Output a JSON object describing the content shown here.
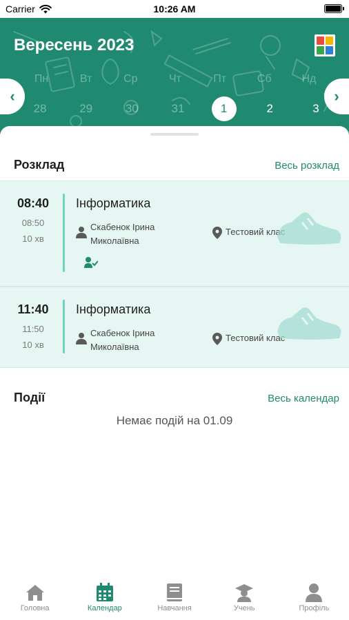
{
  "status_bar": {
    "carrier": "Carrier",
    "time": "10:26 AM"
  },
  "header": {
    "title": "Вересень 2023",
    "weekdays": [
      "Пн",
      "Вт",
      "Ср",
      "Чт",
      "Пт",
      "Сб",
      "Нд"
    ],
    "days": [
      "28",
      "29",
      "30",
      "31",
      "1",
      "2",
      "3"
    ],
    "selected_day": "1"
  },
  "schedule": {
    "title": "Розклад",
    "link": "Весь розклад",
    "lessons": [
      {
        "start": "08:40",
        "end": "08:50",
        "duration": "10 хв",
        "subject": "Інформатика",
        "teacher": "Скабенок Ірина Миколаївна",
        "room": "Тестовий клас"
      },
      {
        "start": "11:40",
        "end": "11:50",
        "duration": "10 хв",
        "subject": "Інформатика",
        "teacher": "Скабенок Ірина Миколаївна",
        "room": "Тестовий клас"
      }
    ]
  },
  "events": {
    "title": "Події",
    "link": "Весь календар",
    "empty_text": "Немає подій на 01.09"
  },
  "tabbar": {
    "items": [
      {
        "label": "Головна",
        "icon": "home-icon"
      },
      {
        "label": "Календар",
        "icon": "calendar-icon"
      },
      {
        "label": "Навчання",
        "icon": "book-icon"
      },
      {
        "label": "Учень",
        "icon": "student-icon"
      },
      {
        "label": "Профіль",
        "icon": "profile-icon"
      }
    ],
    "active": "Календар"
  },
  "colors": {
    "primary": "#1f8a6f",
    "lesson_bg": "#e6f6f3",
    "accent_bar": "#6fd3c0"
  }
}
